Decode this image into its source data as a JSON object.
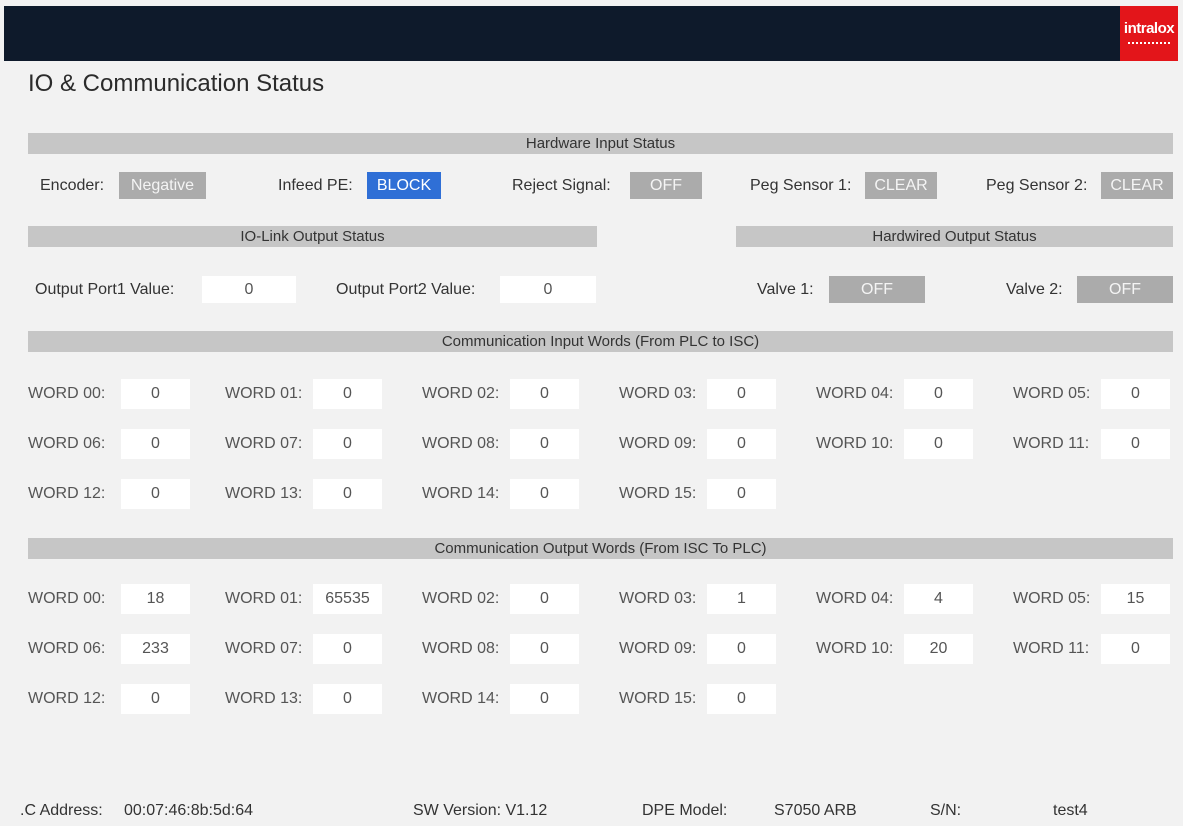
{
  "header": {
    "logo_text": "intralox"
  },
  "page_title": "IO & Communication Status",
  "hardware_input": {
    "title": "Hardware Input Status",
    "items": [
      {
        "label": "Encoder:",
        "value": "Negative",
        "style": "gray"
      },
      {
        "label": "Infeed PE:",
        "value": "BLOCK",
        "style": "blue"
      },
      {
        "label": "Reject Signal:",
        "value": "OFF",
        "style": "gray"
      },
      {
        "label": "Peg Sensor 1:",
        "value": "CLEAR",
        "style": "gray"
      },
      {
        "label": "Peg Sensor 2:",
        "value": "CLEAR",
        "style": "gray"
      }
    ]
  },
  "iolink_output": {
    "title": "IO-Link Output Status",
    "items": [
      {
        "label": "Output Port1 Value:",
        "value": "0"
      },
      {
        "label": "Output Port2 Value:",
        "value": "0"
      }
    ]
  },
  "hardwired_output": {
    "title": "Hardwired Output Status",
    "items": [
      {
        "label": "Valve 1:",
        "value": "OFF"
      },
      {
        "label": "Valve 2:",
        "value": "OFF"
      }
    ]
  },
  "comm_input": {
    "title": "Communication Input Words (From PLC to ISC)",
    "words": [
      {
        "label": "WORD 00:",
        "value": "0"
      },
      {
        "label": "WORD 01:",
        "value": "0"
      },
      {
        "label": "WORD 02:",
        "value": "0"
      },
      {
        "label": "WORD 03:",
        "value": "0"
      },
      {
        "label": "WORD 04:",
        "value": "0"
      },
      {
        "label": "WORD 05:",
        "value": "0"
      },
      {
        "label": "WORD 06:",
        "value": "0"
      },
      {
        "label": "WORD 07:",
        "value": "0"
      },
      {
        "label": "WORD 08:",
        "value": "0"
      },
      {
        "label": "WORD 09:",
        "value": "0"
      },
      {
        "label": "WORD 10:",
        "value": "0"
      },
      {
        "label": "WORD 11:",
        "value": "0"
      },
      {
        "label": "WORD 12:",
        "value": "0"
      },
      {
        "label": "WORD 13:",
        "value": "0"
      },
      {
        "label": "WORD 14:",
        "value": "0"
      },
      {
        "label": "WORD 15:",
        "value": "0"
      }
    ]
  },
  "comm_output": {
    "title": "Communication Output Words (From ISC To PLC)",
    "words": [
      {
        "label": "WORD 00:",
        "value": "18"
      },
      {
        "label": "WORD 01:",
        "value": "65535"
      },
      {
        "label": "WORD 02:",
        "value": "0"
      },
      {
        "label": "WORD 03:",
        "value": "1"
      },
      {
        "label": "WORD 04:",
        "value": "4"
      },
      {
        "label": "WORD 05:",
        "value": "15"
      },
      {
        "label": "WORD 06:",
        "value": "233"
      },
      {
        "label": "WORD 07:",
        "value": "0"
      },
      {
        "label": "WORD 08:",
        "value": "0"
      },
      {
        "label": "WORD 09:",
        "value": "0"
      },
      {
        "label": "WORD 10:",
        "value": "20"
      },
      {
        "label": "WORD 11:",
        "value": "0"
      },
      {
        "label": "WORD 12:",
        "value": "0"
      },
      {
        "label": "WORD 13:",
        "value": "0"
      },
      {
        "label": "WORD 14:",
        "value": "0"
      },
      {
        "label": "WORD 15:",
        "value": "0"
      }
    ]
  },
  "footer": {
    "mac_label": ".C Address:",
    "mac_value": "00:07:46:8b:5d:64",
    "sw_version": "SW Version: V1.12",
    "dpe_label": "DPE Model:",
    "dpe_value": "S7050 ARB",
    "sn_label": "S/N:",
    "sn_value": "test4"
  },
  "colors": {
    "topbar": "#0e1a2b",
    "logo_bg": "#e3151a",
    "badge_gray": "#ababab",
    "badge_blue": "#2f6fd6",
    "section_header": "#c6c6c6"
  }
}
